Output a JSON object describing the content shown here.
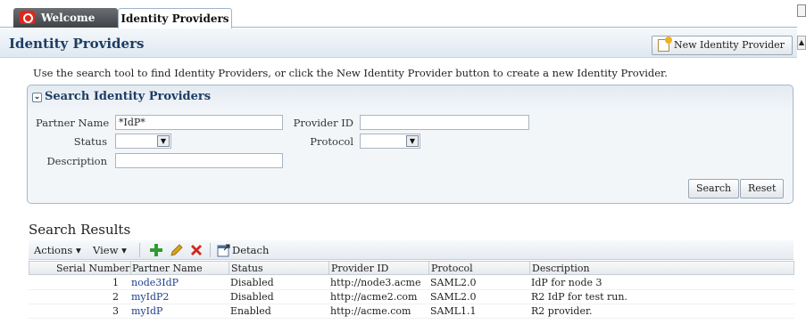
{
  "tabs": [
    {
      "label": "Welcome"
    },
    {
      "label": "Identity Providers"
    }
  ],
  "header": {
    "title": "Identity Providers",
    "new_button": "New Identity Provider"
  },
  "instructions": "Use the search tool to find Identity Providers, or click the New Identity Provider button to create a new Identity Provider.",
  "search": {
    "title": "Search Identity Providers",
    "partner_name_label": "Partner Name",
    "partner_name_value": "*IdP*",
    "status_label": "Status",
    "status_value": "",
    "description_label": "Description",
    "description_value": "",
    "provider_id_label": "Provider ID",
    "provider_id_value": "",
    "protocol_label": "Protocol",
    "protocol_value": "",
    "search_button": "Search",
    "reset_button": "Reset"
  },
  "results": {
    "title": "Search Results",
    "toolbar": {
      "actions": "Actions",
      "view": "View",
      "detach": "Detach",
      "icons": [
        "add-icon",
        "edit-pencil-icon",
        "delete-x-icon",
        "detach-icon"
      ]
    },
    "columns": [
      "Serial Number",
      "Partner Name",
      "Status",
      "Provider ID",
      "Protocol",
      "Description"
    ],
    "rows": [
      {
        "serial": "1",
        "partner": "node3IdP",
        "status": "Disabled",
        "provider_id": "http://node3.acme",
        "protocol": "SAML2.0",
        "description": "IdP for node 3"
      },
      {
        "serial": "2",
        "partner": "myIdP2",
        "status": "Disabled",
        "provider_id": "http://acme2.com",
        "protocol": "SAML2.0",
        "description": "R2 IdP for test run."
      },
      {
        "serial": "3",
        "partner": "myIdP",
        "status": "Enabled",
        "provider_id": "http://acme.com",
        "protocol": "SAML1.1",
        "description": "R2 provider."
      }
    ]
  },
  "colors": {
    "accent": "#1d3d63",
    "link": "#1f3f8c",
    "add": "#2e9c2e",
    "delete": "#d0281b",
    "edit": "#d9a21b"
  }
}
